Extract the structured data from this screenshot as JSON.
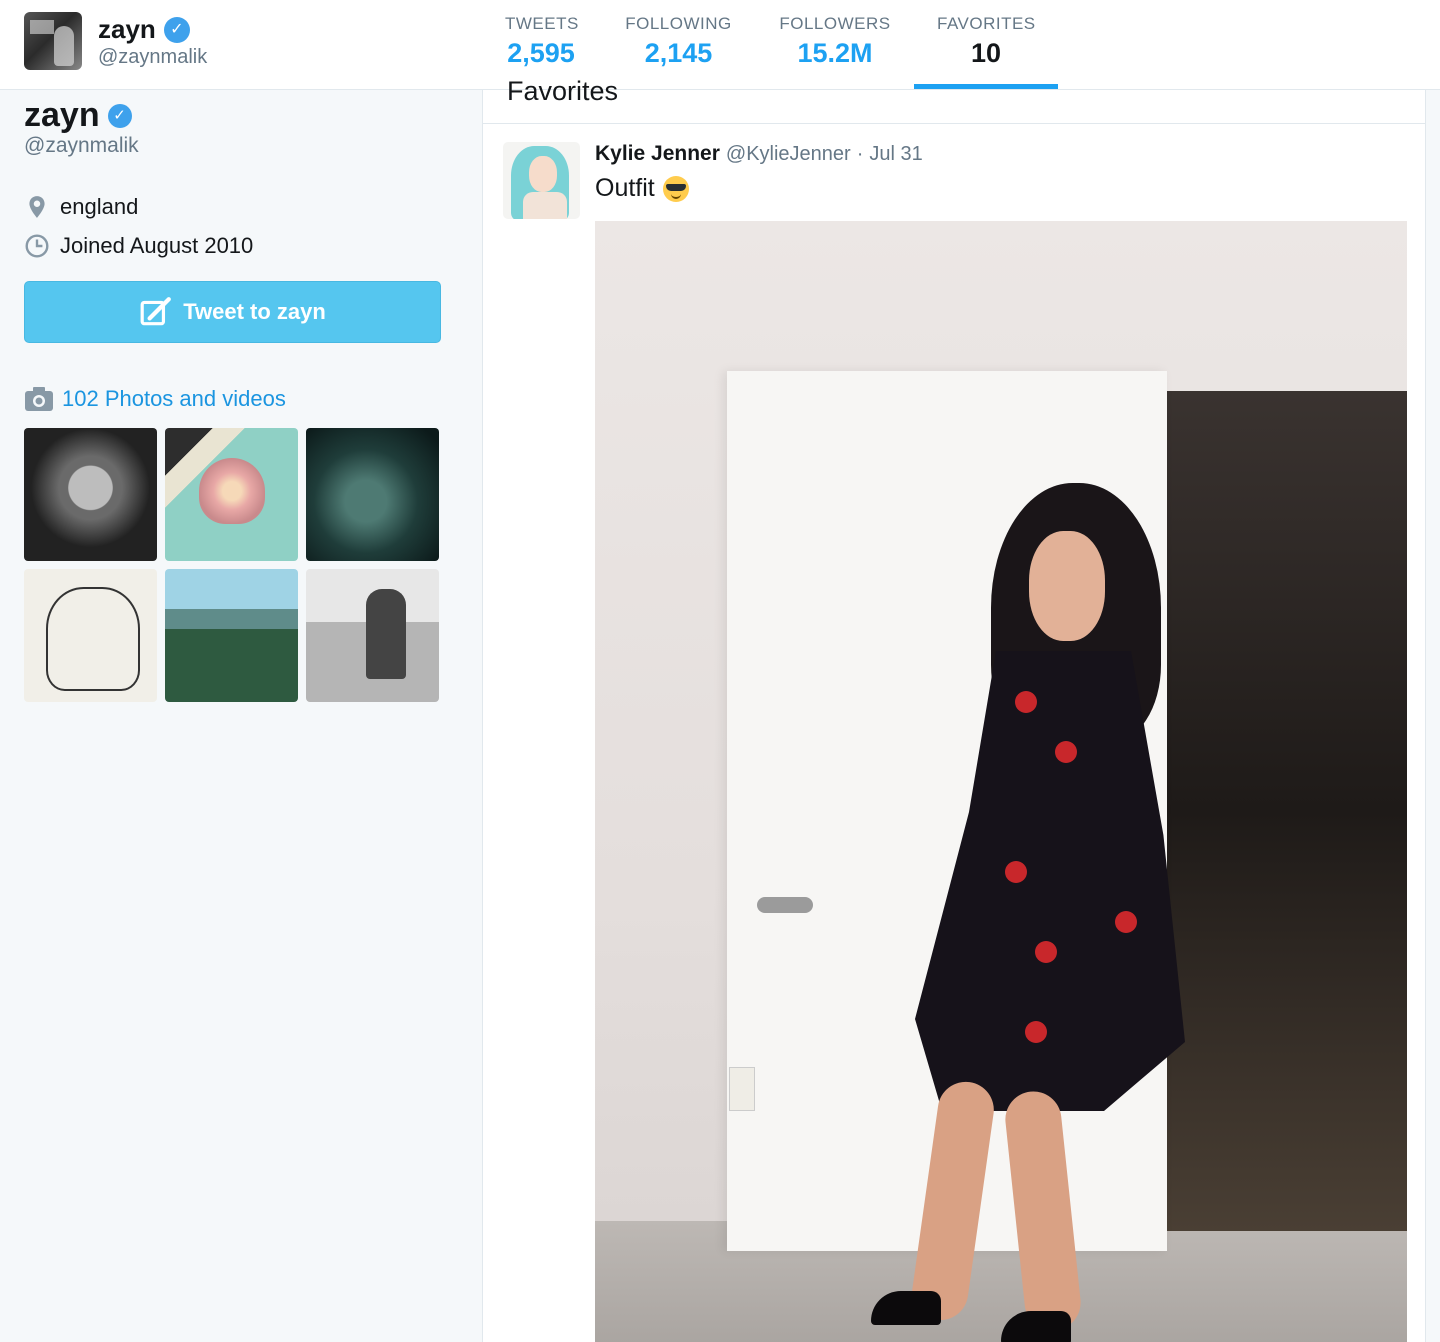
{
  "topbar": {
    "name": "zayn",
    "handle": "@zaynmalik",
    "stats": [
      {
        "label": "TWEETS",
        "value": "2,595"
      },
      {
        "label": "FOLLOWING",
        "value": "2,145"
      },
      {
        "label": "FOLLOWERS",
        "value": "15.2M"
      },
      {
        "label": "FAVORITES",
        "value": "10",
        "active": true
      }
    ]
  },
  "profile": {
    "name": "zayn",
    "handle": "@zaynmalik",
    "location": "england",
    "joined": "Joined August 2010",
    "tweet_button": "Tweet to zayn",
    "photos_link": "102 Photos and videos"
  },
  "main": {
    "heading": "Favorites",
    "tweet": {
      "author": "Kylie Jenner",
      "screen_name": "@KylieJenner",
      "separator": "·",
      "time": "Jul 31",
      "text": "Outfit",
      "emoji": "sunglasses-face-emoji"
    }
  },
  "colors": {
    "accent": "#1da1f2",
    "button": "#55c6ef",
    "verified": "#3ea1ec",
    "link": "#1b95e0"
  }
}
